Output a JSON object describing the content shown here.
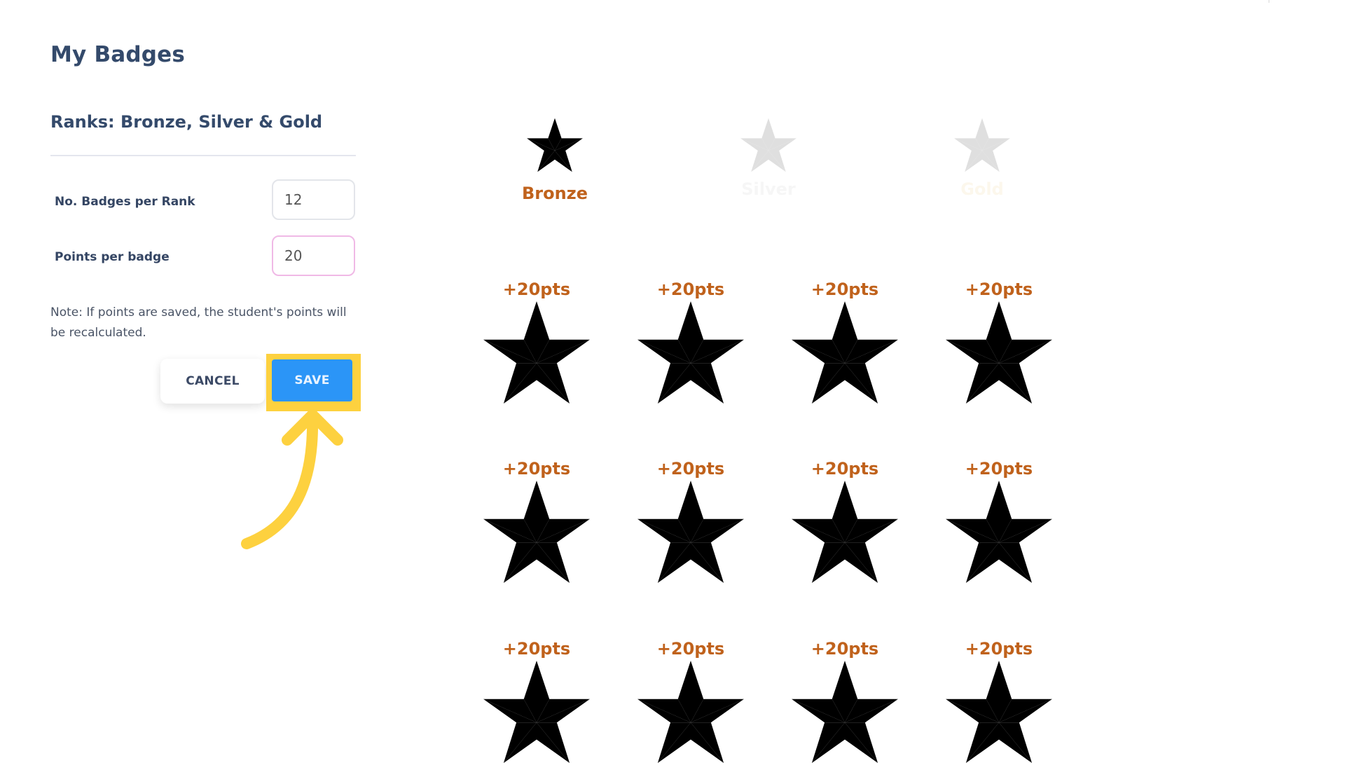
{
  "page": {
    "title": "My Badges",
    "section_title": "Ranks: Bronze, Silver & Gold"
  },
  "form": {
    "badges_per_rank": {
      "label": "No. Badges per Rank",
      "value": "12"
    },
    "points_per_badge": {
      "label": "Points per badge",
      "value": "20"
    },
    "note": "Note: If points are saved, the student's points will be recalculated.",
    "cancel_label": "CANCEL",
    "save_label": "SAVE"
  },
  "ranks": [
    {
      "name": "Bronze",
      "active": true,
      "icon": "star-icon",
      "color": "#c0621c"
    },
    {
      "name": "Silver",
      "active": false,
      "icon": "star-icon",
      "color": "#b8b8b8"
    },
    {
      "name": "Gold",
      "active": false,
      "icon": "star-icon",
      "color": "#e8c66a"
    }
  ],
  "badges": [
    {
      "points": "+20pts",
      "icon": "bronze-star-icon"
    },
    {
      "points": "+20pts",
      "icon": "bronze-star-icon"
    },
    {
      "points": "+20pts",
      "icon": "bronze-star-icon"
    },
    {
      "points": "+20pts",
      "icon": "bronze-star-icon"
    },
    {
      "points": "+20pts",
      "icon": "bronze-star-icon"
    },
    {
      "points": "+20pts",
      "icon": "bronze-star-icon"
    },
    {
      "points": "+20pts",
      "icon": "bronze-star-icon"
    },
    {
      "points": "+20pts",
      "icon": "bronze-star-icon"
    },
    {
      "points": "+20pts",
      "icon": "bronze-star-icon"
    },
    {
      "points": "+20pts",
      "icon": "bronze-star-icon"
    },
    {
      "points": "+20pts",
      "icon": "bronze-star-icon"
    },
    {
      "points": "+20pts",
      "icon": "bronze-star-icon"
    }
  ],
  "colors": {
    "text_primary": "#344a6b",
    "accent_blue": "#2b95f7",
    "highlight_yellow": "#fdd13f",
    "bronze_label": "#c0621c",
    "bronze_light": "#e3803f",
    "bronze_dark": "#b3582c",
    "bronze_deep": "#8f4526",
    "silver_light": "#f4f4f4",
    "silver_dark": "#d9d9d9",
    "gold_light": "#fbf3dc",
    "gold_dark": "#efe0b6"
  }
}
